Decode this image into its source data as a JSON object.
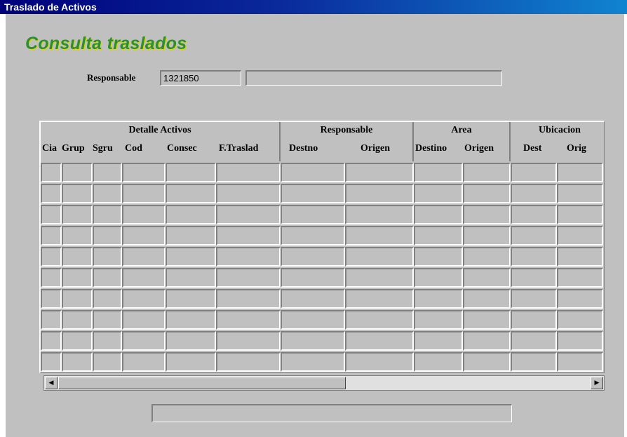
{
  "window": {
    "title": "Traslado de Activos"
  },
  "header": {
    "title": "Consulta traslados"
  },
  "responsable": {
    "label": "Responsable",
    "code": "1321850",
    "name": ""
  },
  "grid": {
    "groups": [
      {
        "label": "Detalle Activos"
      },
      {
        "label": "Responsable"
      },
      {
        "label": "Area"
      },
      {
        "label": "Ubicacion"
      }
    ],
    "columns": [
      {
        "label": "Cia"
      },
      {
        "label": "Grup"
      },
      {
        "label": "Sgru"
      },
      {
        "label": "Cod"
      },
      {
        "label": "Consec"
      },
      {
        "label": "F.Traslad"
      },
      {
        "label": "Destno"
      },
      {
        "label": "Origen"
      },
      {
        "label": "Destino"
      },
      {
        "label": "Origen"
      },
      {
        "label": "Dest"
      },
      {
        "label": "Orig"
      }
    ],
    "row_count": 10
  },
  "status_bar": {
    "text": ""
  },
  "icons": {
    "scroll_left": "arrow-left-icon",
    "scroll_right": "arrow-right-icon"
  }
}
